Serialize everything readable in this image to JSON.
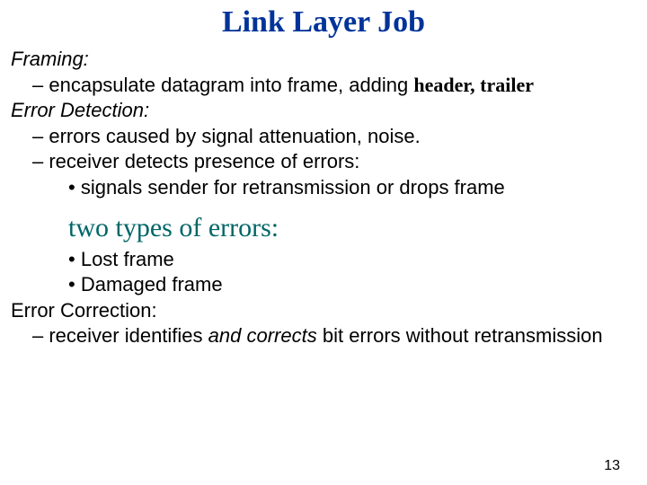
{
  "title": "Link Layer Job",
  "framing": {
    "heading": "Framing:",
    "bullet1_prefix": "encapsulate datagram into frame, adding ",
    "bullet1_bold": "header, trailer"
  },
  "error_detection": {
    "heading": "Error Detection:",
    "bullet1": "errors caused by signal attenuation, noise.",
    "bullet2": "receiver detects presence of errors:",
    "sub1": "signals sender for retransmission or drops frame"
  },
  "errors_types": {
    "heading": "two types of errors:",
    "item1": "Lost frame",
    "item2": "Damaged frame"
  },
  "error_correction": {
    "heading": "Error Correction:",
    "bullet1_prefix": "receiver identifies ",
    "bullet1_italic": "and corrects",
    "bullet1_suffix": " bit errors without retransmission"
  },
  "page_number": "13"
}
